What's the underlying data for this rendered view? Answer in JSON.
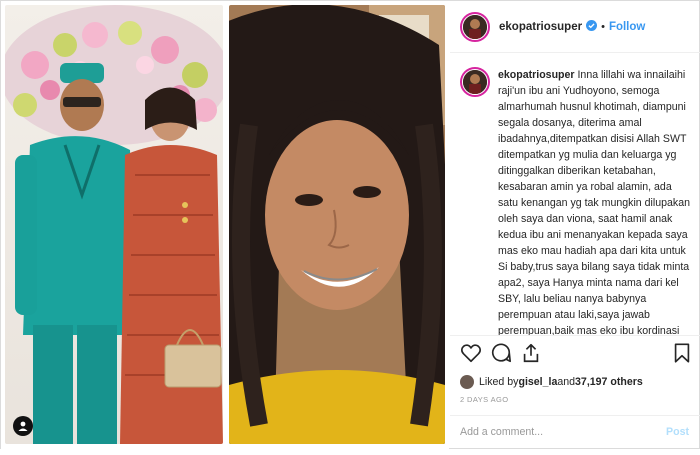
{
  "header": {
    "username": "ekopatriosuper",
    "separator": "•",
    "follow_label": "Follow"
  },
  "caption": {
    "username": "ekopatriosuper",
    "text": "Inna lillahi wa innailaihi raji'un ibu ani Yudhoyono, semoga almarhumah husnul khotimah, diampuni segala dosanya, diterima amal ibadahnya,ditempatkan disisi Allah SWT ditempatkan yg mulia dan keluarga yg ditinggalkan diberikan ketabahan, kesabaran amin ya robal alamin, ada satu kenangan yg tak mungkin dilupakan oleh saya dan viona, saat hamil anak kedua ibu ani menanyakan kepada saya mas eko mau hadiah apa dari kita untuk Si baby,trus saya bilang saya tidak minta apa2, saya Hanya minta nama dari kel SBY, lalu beliau nanya babynya perempuan atau laki,saya jawab perempuan,baik mas eko ibu kordinasi dgn bapak dulu yah, Baru besoknya,"
  },
  "likes": {
    "prefix": "Liked by ",
    "first_user": "gisel_la",
    "middle": " and ",
    "count": "37,197 others"
  },
  "timestamp": "2 DAYS AGO",
  "comment": {
    "placeholder": "Add a comment...",
    "post_label": "Post"
  },
  "icons": {
    "like": "heart-icon",
    "comment": "comment-icon",
    "share": "share-icon",
    "save": "bookmark-icon",
    "verified": "verified-badge-icon",
    "user_tag": "user-tag-icon"
  },
  "colors": {
    "link_blue": "#3897f0",
    "verified_blue": "#3897f0",
    "post_disabled": "#b2dffc",
    "muted": "#999999",
    "border": "#efefef"
  }
}
